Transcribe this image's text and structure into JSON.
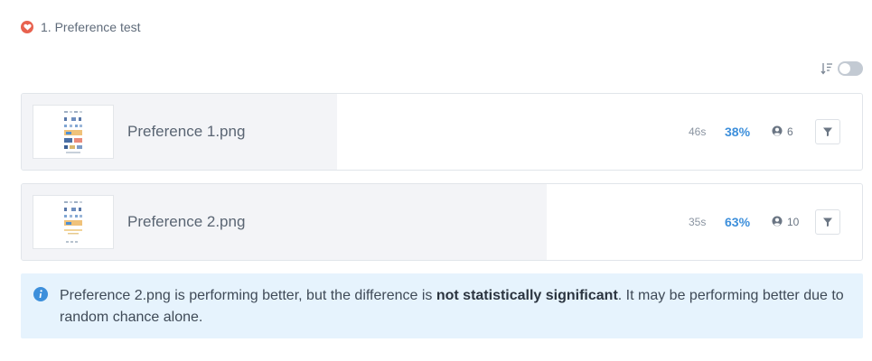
{
  "header": {
    "title": "1. Preference test",
    "badge_color": "#e8624f"
  },
  "toolbar": {
    "sort_icon": "sort-descending-icon",
    "toggle_on": false
  },
  "options": [
    {
      "name": "Preference 1.png",
      "time": "46s",
      "percent": "38%",
      "percent_value": 38,
      "users": "6"
    },
    {
      "name": "Preference 2.png",
      "time": "35s",
      "percent": "63%",
      "percent_value": 63,
      "users": "10"
    }
  ],
  "info": {
    "text_before": "Preference 2.png is performing better, but the difference is ",
    "text_bold": "not statistically significant",
    "text_after": ". It may be performing better due to random chance alone."
  },
  "colors": {
    "accent": "#3d8fdb",
    "info_bg": "#e6f3fd",
    "bar_fill": "#f3f4f7"
  }
}
